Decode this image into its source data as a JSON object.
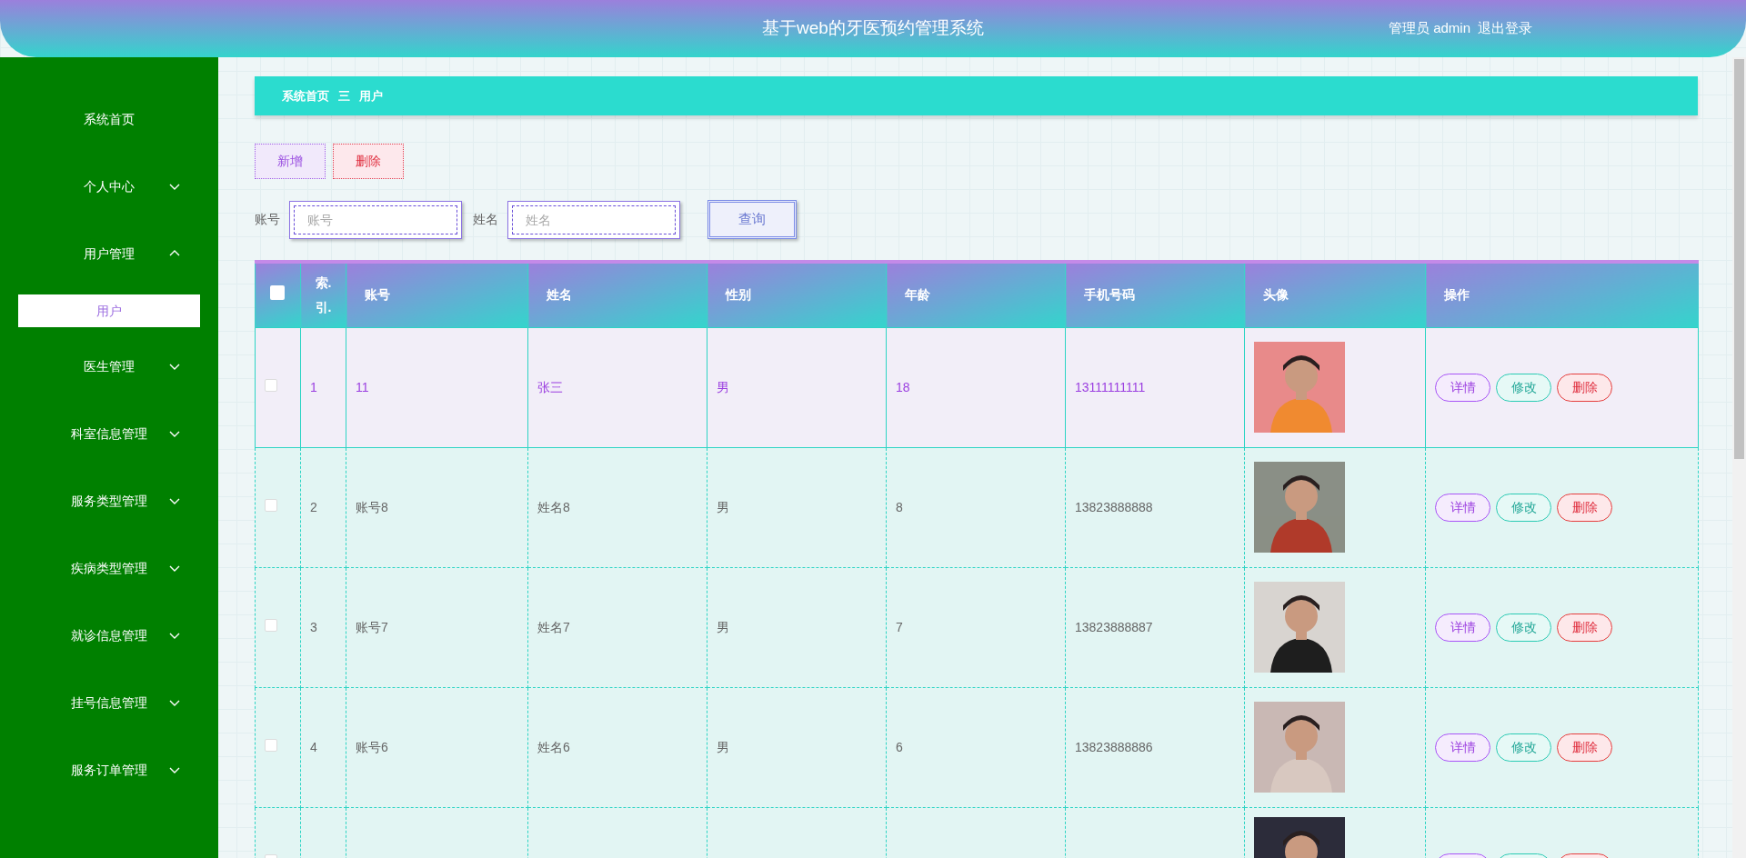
{
  "header": {
    "title": "基于web的牙医预约管理系统",
    "user": "管理员 admin",
    "logout": "退出登录"
  },
  "sidebar": {
    "items": [
      {
        "label": "系统首页",
        "kind": "link"
      },
      {
        "label": "个人中心",
        "expanded": false
      },
      {
        "label": "用户管理",
        "expanded": true,
        "children": [
          {
            "label": "用户",
            "selected": true
          }
        ]
      },
      {
        "label": "医生管理",
        "expanded": false
      },
      {
        "label": "科室信息管理",
        "expanded": false
      },
      {
        "label": "服务类型管理",
        "expanded": false
      },
      {
        "label": "疾病类型管理",
        "expanded": false
      },
      {
        "label": "就诊信息管理",
        "expanded": false
      },
      {
        "label": "挂号信息管理",
        "expanded": false
      },
      {
        "label": "服务订单管理",
        "expanded": false
      }
    ]
  },
  "breadcrumb": {
    "items": [
      "系统首页",
      "用户"
    ],
    "separator": "三"
  },
  "toolbar": {
    "buttons": [
      {
        "label": "新增",
        "kind": "add"
      },
      {
        "label": "删除",
        "kind": "delete"
      }
    ]
  },
  "search": {
    "fields": [
      {
        "label": "账号",
        "placeholder": "账号"
      },
      {
        "label": "姓名",
        "placeholder": "姓名"
      }
    ],
    "button": "查询"
  },
  "table": {
    "select_all_checked": false,
    "columns": [
      "索.引.",
      "账号",
      "姓名",
      "性别",
      "年龄",
      "手机号码",
      "头像",
      "操作"
    ],
    "rows": [
      {
        "selected": true,
        "checked": false,
        "cells": [
          "1",
          "11",
          "张三",
          "男",
          "18",
          "13111111111"
        ],
        "avatar": {
          "kind": "picture"
        },
        "actions": [
          {
            "label": "详情",
            "kind": "detail"
          },
          {
            "label": "修改",
            "kind": "edit"
          },
          {
            "label": "删除",
            "kind": "delete"
          }
        ]
      },
      {
        "selected": false,
        "checked": false,
        "cells": [
          "2",
          "账号8",
          "姓名8",
          "男",
          "8",
          "13823888888"
        ],
        "avatar": {
          "kind": "picture"
        },
        "actions": [
          {
            "label": "详情",
            "kind": "detail"
          },
          {
            "label": "修改",
            "kind": "edit"
          },
          {
            "label": "删除",
            "kind": "delete"
          }
        ]
      },
      {
        "selected": false,
        "checked": false,
        "cells": [
          "3",
          "账号7",
          "姓名7",
          "男",
          "7",
          "13823888887"
        ],
        "avatar": {
          "kind": "picture"
        },
        "actions": [
          {
            "label": "详情",
            "kind": "detail"
          },
          {
            "label": "修改",
            "kind": "edit"
          },
          {
            "label": "删除",
            "kind": "delete"
          }
        ]
      },
      {
        "selected": false,
        "checked": false,
        "cells": [
          "4",
          "账号6",
          "姓名6",
          "男",
          "6",
          "13823888886"
        ],
        "avatar": {
          "kind": "picture"
        },
        "actions": [
          {
            "label": "详情",
            "kind": "detail"
          },
          {
            "label": "修改",
            "kind": "edit"
          },
          {
            "label": "删除",
            "kind": "delete"
          }
        ]
      }
    ],
    "partial_rows": [
      {
        "checked": false,
        "avatar": {
          "kind": "picture"
        },
        "actions": [
          {
            "kind": "detail"
          },
          {
            "kind": "edit"
          },
          {
            "kind": "delete"
          }
        ]
      }
    ]
  }
}
